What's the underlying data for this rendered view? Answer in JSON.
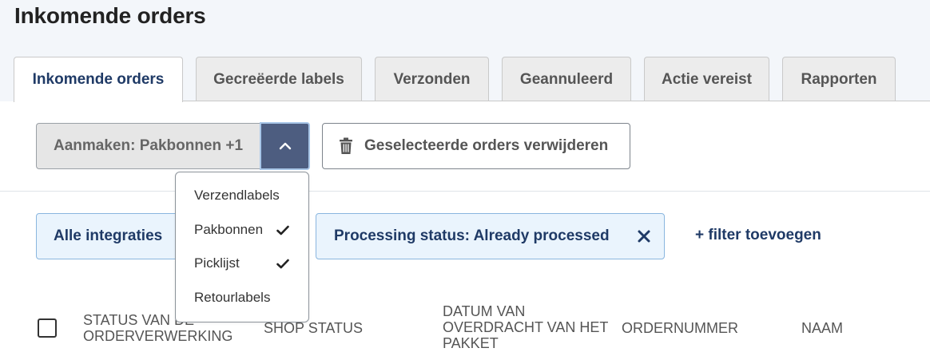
{
  "page": {
    "title": "Inkomende orders"
  },
  "tabs": [
    {
      "label": "Inkomende orders",
      "active": true
    },
    {
      "label": "Gecreëerde labels",
      "active": false
    },
    {
      "label": "Verzonden",
      "active": false
    },
    {
      "label": "Geannuleerd",
      "active": false
    },
    {
      "label": "Actie vereist",
      "active": false
    },
    {
      "label": "Rapporten",
      "active": false
    }
  ],
  "toolbar": {
    "create_label": "Aanmaken: Pakbonnen +1",
    "delete_label": "Geselecteerde orders verwijderen"
  },
  "dropdown": {
    "items": [
      {
        "label": "Verzendlabels",
        "checked": false
      },
      {
        "label": "Pakbonnen",
        "checked": true
      },
      {
        "label": "Picklijst",
        "checked": true
      },
      {
        "label": "Retourlabels",
        "checked": false
      }
    ]
  },
  "filters": {
    "integrations_label": "Alle integraties",
    "status_label": "Processing status: Already processed",
    "add_filter_label": "+ filter toevoegen"
  },
  "table": {
    "columns": [
      "STATUS VAN DE ORDERVERWERKING",
      "SHOP STATUS",
      "DATUM VAN OVERDRACHT VAN HET PAKKET",
      "ORDERNUMMER",
      "NAAM"
    ]
  },
  "colors": {
    "accent": "#1f3a66",
    "toggle": "#4d5d80",
    "chip_bg": "#eaf4fd",
    "chip_border": "#8ab6df"
  }
}
